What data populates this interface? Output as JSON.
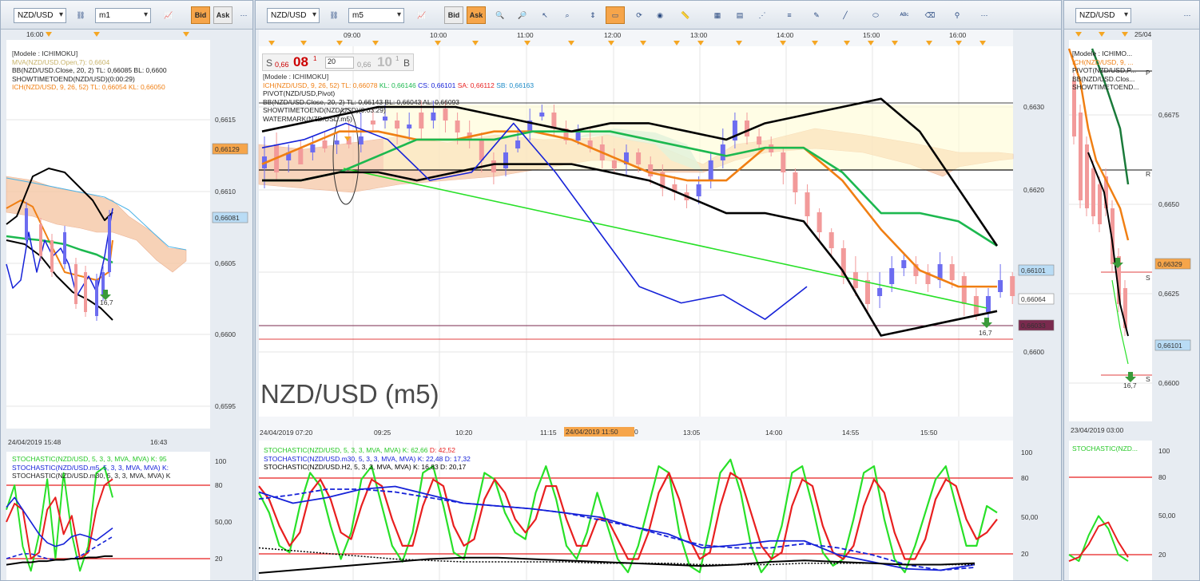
{
  "colors": {
    "bg": "#ffffff",
    "grid": "#e6e6e6",
    "up": "#6c6cf0",
    "down": "#f29a9a",
    "ichi": "#f07f13",
    "kijun": "#1cb84f",
    "bb": "#000000",
    "green": "#28e028",
    "blue": "#1622d8",
    "red": "#e81f1f",
    "accent": "#f6a54a"
  },
  "left": {
    "symbol": "NZD/USD",
    "timeframe": "m1",
    "bid": "Bid",
    "ask": "Ask",
    "top_time": "16:00",
    "legend": [
      "[Modele : ICHIMOKU]",
      "MVA(NZD/USD.Open,7): 0,6604",
      "BB(NZD/USD.Close, 20, 2)  TL: 0,66085  BL: 0,6600",
      "SHOWTIMETOEND(NZD/USD)(0:00:29)",
      "ICH(NZD/USD, 9, 26, 52)  TL: 0,66054  KL: 0,66050"
    ],
    "y_ticks": [
      "0,6615",
      "0,6610",
      "0,6605",
      "0,6600",
      "0,6595"
    ],
    "price_tags": [
      "0,66129",
      "0,66081"
    ],
    "count_label": "16,7",
    "bottom_time": "24/04/2019 15:48",
    "bottom_time2": "16:43",
    "stoch_legend": [
      "STOCHASTIC(NZD/USD, 5, 3, 3, MVA, MVA)  K: 95",
      "STOCHASTIC(NZD/USD.m5, 5, 3, 3, MVA, MVA)  K:",
      "STOCHASTIC(NZD/USD.m30, 5, 3, 3, MVA, MVA)  K"
    ],
    "stoch_ticks": [
      "100",
      "80",
      "50,00",
      "20"
    ]
  },
  "center": {
    "symbol": "NZD/USD",
    "timeframe": "m5",
    "bid": "Bid",
    "ask": "Ask",
    "trade_widget": {
      "sell": "S",
      "sell_small": "0,66",
      "sell_big": "08",
      "sell_sup": "1",
      "qty": "20",
      "buy_small": "0,66",
      "buy_big": "10",
      "buy_sup": "1",
      "buy": "B"
    },
    "top_times": [
      "09:00",
      "10:00",
      "11:00",
      "12:00",
      "13:00",
      "14:00",
      "15:00",
      "16:00"
    ],
    "legend": [
      {
        "t": "[Modele : ICHIMOKU]",
        "c": "#333"
      },
      {
        "t": "ICH(NZD/USD, 9, 26, 52)  TL: 0,66078",
        "c": "#f07f13",
        "k": "KL: 0,66146",
        "kc": "#1cb84f",
        "x1": "CS: 0,66101",
        "x1c": "#1622d8",
        "x2": "SA: 0,66112",
        "x2c": "#e81f1f",
        "x3": "SB: 0,66163",
        "x3c": "#1b8ac7"
      },
      {
        "t": "PIVOT(NZD/USD,Pivot)",
        "c": "#222"
      },
      {
        "t": "BB(NZD/USD.Close, 20, 2)  TL: 0,66143  BL: 0,66043  AL: 0,66093",
        "c": "#222"
      },
      {
        "t": "SHOWTIMETOEND(NZD/USD)(0:03:29)",
        "c": "#222"
      },
      {
        "t": "WATERMARK(NZD/USD.m5)",
        "c": "#222"
      }
    ],
    "y_ticks": [
      "0,6630",
      "0,6620",
      "0,6610",
      "0,6600"
    ],
    "price_tags": [
      {
        "v": "0,66101",
        "bg": "#b9dcf5",
        "fg": "#000"
      },
      {
        "v": "0,66064",
        "bg": "#fff",
        "fg": "#000"
      },
      {
        "v": "0,66033",
        "bg": "#7a2a4e",
        "fg": "#fff"
      }
    ],
    "watermark": "NZD/USD (m5)",
    "count_label": "16,7",
    "bottom_times": [
      "24/04/2019 07:20",
      "09:25",
      "10:20",
      "11:15",
      "13:05",
      "14:00",
      "14:55",
      "15:50"
    ],
    "cursor_time": "24/04/2019 11:50",
    "cursor_time_suffix": "0",
    "stoch_legend": [
      {
        "t": "STOCHASTIC(NZD/USD, 5, 3, 3, MVA, MVA)  K: 62,66",
        "c": "#28c828",
        "d": "D: 42,52",
        "dc": "#e81f1f"
      },
      {
        "t": "STOCHASTIC(NZD/USD.m30, 5, 3, 3, MVA, MVA)  K: 22,48  D: 17,32",
        "c": "#1622d8"
      },
      {
        "t": "STOCHASTIC(NZD/USD.H2, 5, 3, 3, MVA, MVA)  K: 16,83  D: 20,17",
        "c": "#000"
      }
    ],
    "stoch_ticks": [
      "100",
      "80",
      "50,00",
      "20"
    ]
  },
  "right": {
    "symbol": "NZD/USD",
    "top_time": "25/04",
    "legend": [
      "[Modele : ICHIMO...",
      "ICH(NZD/USD, 9, ...",
      "PIVOT(NZD/USD,P...",
      "BB(NZD/USD.Clos...",
      "SHOWTIMETOEND..."
    ],
    "y_ticks": [
      "0,6675",
      "0,6650",
      "0,6625",
      "0,6600"
    ],
    "price_tags": [
      "0,66329",
      "0,66101"
    ],
    "pivot_labels": [
      "P",
      "R",
      "S",
      "S"
    ],
    "count_label": "16,7",
    "bottom_time": "23/04/2019 03:00",
    "stoch_legend": "STOCHASTIC(NZD...",
    "stoch_ticks": [
      "100",
      "80",
      "50,00",
      "20"
    ]
  },
  "chart_data": [
    {
      "type": "line",
      "title": "NZD/USD (m5)",
      "ylim": [
        0.6595,
        0.6634
      ],
      "series": [
        {
          "name": "ICH TL",
          "values": [
            0.6623,
            0.6625,
            0.6627,
            0.6627,
            0.6626,
            0.6626,
            0.6627,
            0.6627,
            0.6626,
            0.6624,
            0.6622,
            0.6621,
            0.6621,
            0.6625,
            0.6625,
            0.6621,
            0.6615,
            0.661,
            0.6608,
            0.6608
          ]
        },
        {
          "name": "ICH KL",
          "values": [
            0.6621,
            0.6621,
            0.6622,
            0.6624,
            0.6626,
            0.6626,
            0.6626,
            0.6627,
            0.6627,
            0.6627,
            0.6626,
            0.6625,
            0.6624,
            0.6625,
            0.6625,
            0.6622,
            0.6617,
            0.6617,
            0.6616,
            0.6613
          ]
        },
        {
          "name": "BB TL",
          "values": [
            0.6627,
            0.6628,
            0.6629,
            0.663,
            0.663,
            0.663,
            0.6629,
            0.6628,
            0.6627,
            0.6628,
            0.6628,
            0.6627,
            0.6626,
            0.6628,
            0.6629,
            0.663,
            0.6631,
            0.6627,
            0.662,
            0.6613
          ]
        },
        {
          "name": "BB BL",
          "values": [
            0.6621,
            0.6621,
            0.6622,
            0.6622,
            0.6621,
            0.6622,
            0.6623,
            0.6623,
            0.6623,
            0.6622,
            0.6621,
            0.6619,
            0.6617,
            0.6617,
            0.6616,
            0.661,
            0.6602,
            0.6603,
            0.6604,
            0.6605
          ]
        },
        {
          "name": "CS",
          "values": [
            0.6625,
            0.6626,
            0.6628,
            0.6626,
            0.6621,
            0.6622,
            0.6628,
            0.6622,
            0.6615,
            0.6608,
            0.6606,
            0.6607,
            0.6604,
            0.6608
          ]
        }
      ]
    }
  ]
}
